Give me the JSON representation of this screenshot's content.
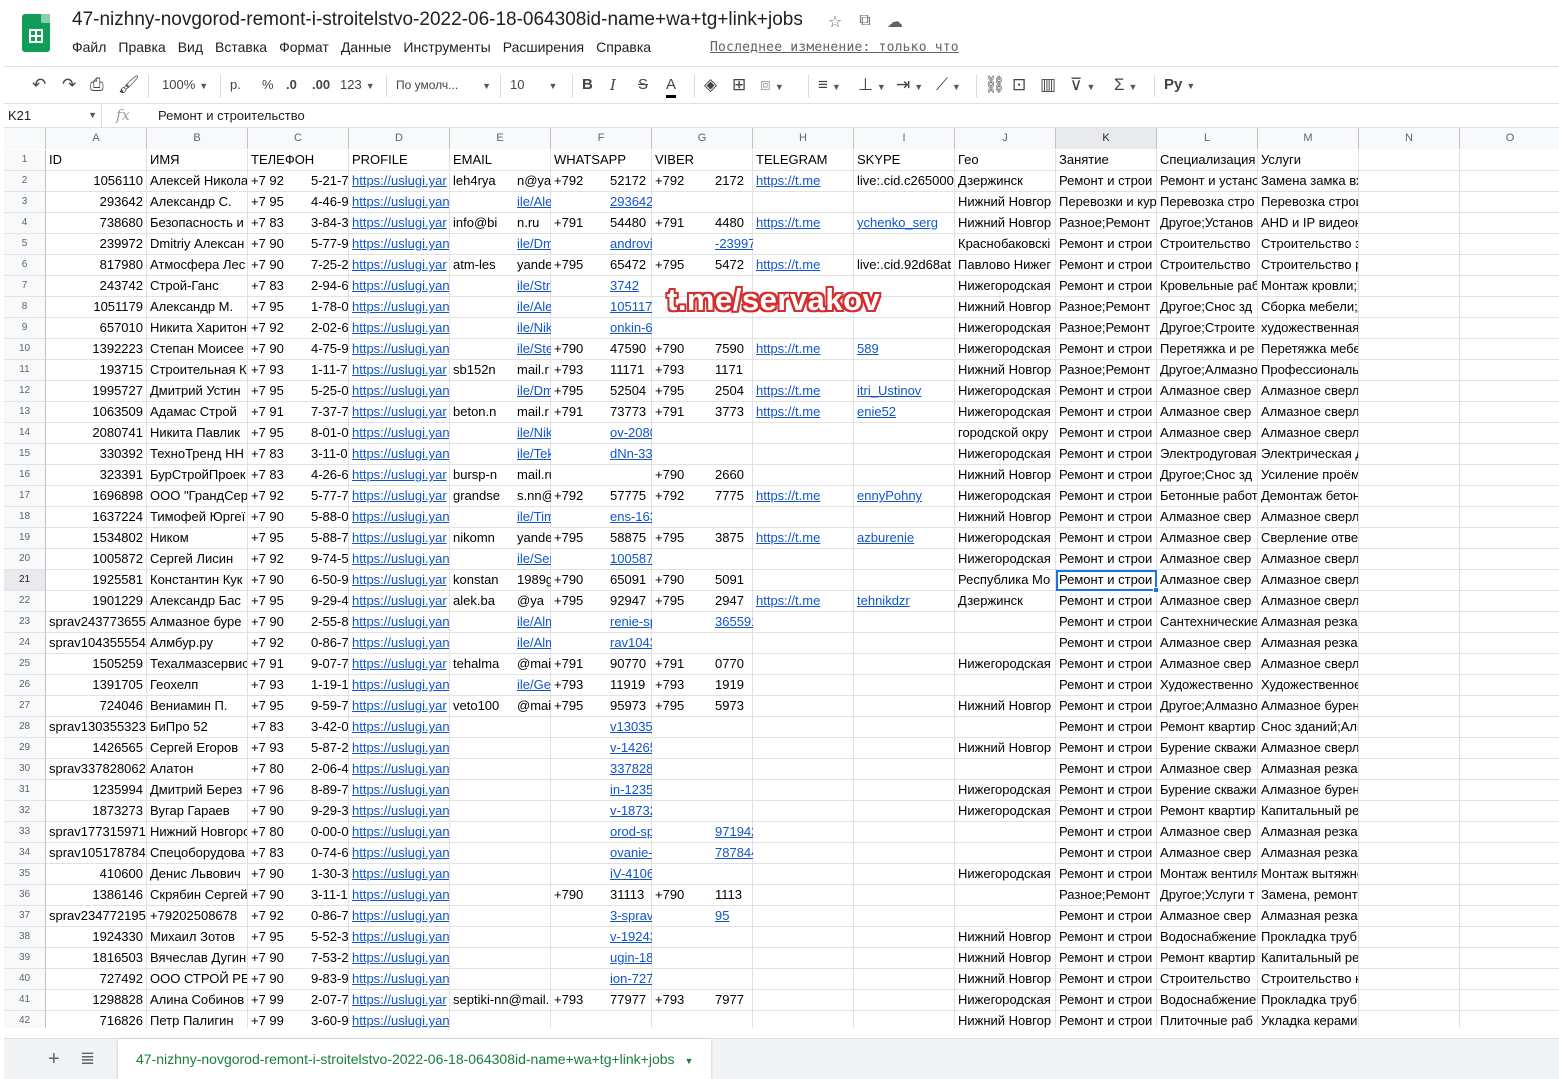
{
  "app": {
    "title": "47-nizhny-novgorod-remont-i-stroitelstvo-2022-06-18-064308id-name+wa+tg+link+jobs"
  },
  "menu": [
    "Файл",
    "Правка",
    "Вид",
    "Вставка",
    "Формат",
    "Данные",
    "Инструменты",
    "Расширения",
    "Справка"
  ],
  "last_edit": "Последнее изменение: только что",
  "title_icons": [
    "star-icon",
    "move-to-folder-icon",
    "cloud-status-icon"
  ],
  "toolbar": {
    "zoom": "100%",
    "currency": "р.",
    "percent": "%",
    "dec_decrease": ".0",
    "dec_increase": ".00",
    "more_formats": "123",
    "font": "По умолч...",
    "font_size": "10",
    "bold": "B",
    "italic": "I",
    "strike": "S",
    "text_color": "A",
    "input_tools": "Py"
  },
  "formula": {
    "namebox": "K21",
    "fx": "fx",
    "value": "Ремонт и строительство"
  },
  "columns": [
    "A",
    "B",
    "C",
    "D",
    "E",
    "F",
    "G",
    "H",
    "I",
    "J",
    "K",
    "L",
    "M",
    "N",
    "O"
  ],
  "active_column": "K",
  "active_row": 21,
  "rows": [
    {
      "n": 1,
      "c": {
        "A": "ID",
        "B": "ИМЯ",
        "C": "ТЕЛЕФОН",
        "D": "PROFILE",
        "E": "EMAIL",
        "F": "WHATSAPP",
        "G": "VIBER",
        "H": "TELEGRAM",
        "I": "SKYPE",
        "J": "Гео",
        "K": "Занятие",
        "L": "Специализация",
        "M": "Услуги"
      }
    },
    {
      "n": 2,
      "c": {
        "A": "1056110",
        "B": "Алексей Никола",
        "C": "+7 92",
        "C2": "5-21-7",
        "D": "https://uslugi.yar",
        "E": "leh4rya",
        "E2": "n@ya",
        "F": "+792",
        "F2": "52172",
        "G": "+792",
        "G2": "2172",
        "H": "https://t.me",
        "I": "live:.cid.c265000",
        "J": "Дзержинск",
        "K": "Ремонт и строи",
        "L": "Ремонт и устано",
        "M": "Замена замка входной двери;Установка замка д"
      }
    },
    {
      "n": 3,
      "c": {
        "A": "293642",
        "B": "Александр С.",
        "C": "+7 95",
        "C2": "4-46-9",
        "D": "https://uslugi.yandex.ru/p",
        "E2": "ile/Aleksan",
        "F2": "293642",
        "J": "Нижний Новгор",
        "K": "Перевозки и кур",
        "L": "Перевозка стро",
        "M": "Перевозка строительных грузов и оборудования"
      }
    },
    {
      "n": 4,
      "c": {
        "A": "738680",
        "B": "Безопасность и",
        "C": "+7 83",
        "C2": "3-84-3",
        "D": "https://uslugi.yar",
        "E": "info@bi",
        "E2": "n.ru",
        "F": "+791",
        "F2": "54480",
        "G": "+791",
        "G2": "4480",
        "H": "https://t.me",
        "I2": "ychenko_serg",
        "J": "Нижний Новгор",
        "K": "Разное;Ремонт",
        "L": "Другое;Установ",
        "M": "AHD и IP видеонаблюдения;Контроль обхода пе"
      }
    },
    {
      "n": 5,
      "c": {
        "A": "239972",
        "B": "Dmitriy Алексан",
        "C": "+7 90",
        "C2": "5-77-9",
        "D": "https://uslugi.yandex.ru/p",
        "E2": "ile/DmitriyA",
        "F2": "androvichUs",
        "G2": "-239972",
        "J": "Краснобаковскі",
        "K": "Ремонт и строи",
        "L": "Строительство",
        "M": "Строительство забора из профнастила;Монтаж"
      }
    },
    {
      "n": 6,
      "c": {
        "A": "817980",
        "B": "Атмосфера Лес",
        "C": "+7 90",
        "C2": "7-25-2",
        "D": "https://uslugi.yar",
        "E": "atm-les",
        "E2": "yande",
        "F": "+795",
        "F2": "65472",
        "G": "+795",
        "G2": "5472",
        "H": "https://t.me",
        "I": "live:.cid.92d68at",
        "J": "Павлово Нижег",
        "K": "Ремонт и строи",
        "L": "Строительство",
        "M": "Строительство русской бани;Строительство фи"
      }
    },
    {
      "n": 7,
      "c": {
        "A": "243742",
        "B": "Строй-Ганс",
        "C": "+7 83",
        "C2": "2-94-6",
        "D": "https://uslugi.yandex.ru/p",
        "E2": "ile/Strojgan",
        "F2": "3742",
        "J": "Нижегородская",
        "K": "Ремонт и строи",
        "L": "Кровельные раб",
        "M": "Монтаж кровли;Укладка утеплителя кровли;Мон"
      }
    },
    {
      "n": 8,
      "c": {
        "A": "1051179",
        "B": "Александр М.",
        "C": "+7 95",
        "C2": "1-78-0",
        "D": "https://uslugi.yandex.ru/p",
        "E2": "ile/Aleksan",
        "F2": "1051179",
        "J": "Нижний Новгор",
        "K": "Разное;Ремонт",
        "L": "Другое;Снос зд",
        "M": "Сборка мебели;Демонтаж кирпичной кладки;Де"
      }
    },
    {
      "n": 9,
      "c": {
        "A": "657010",
        "B": "Никита Харитон",
        "C": "+7 92",
        "C2": "2-02-6",
        "D": "https://uslugi.yandex.ru/p",
        "E2": "ile/NikitaKh",
        "F2": "onkin-657010",
        "J": "Нижегородская",
        "K": "Разное;Ремонт",
        "L": "Другое;Строите",
        "M": "художественная ковка;Строительство забора из"
      }
    },
    {
      "n": 10,
      "c": {
        "A": "1392223",
        "B": "Степан Моисее",
        "C": "+7 90",
        "C2": "4-75-9",
        "D": "https://uslugi.yandex.ru/p",
        "E2": "ile/Ste",
        "F": "+790",
        "F2": "47590",
        "G": "+790",
        "G2": "7590",
        "H": "https://t.me",
        "I2": "589",
        "J": "Нижегородская",
        "K": "Ремонт и строи",
        "L": "Перетяжка и ре",
        "M": "Перетяжка мебели;Перетяжка мебели;Замена н"
      }
    },
    {
      "n": 11,
      "c": {
        "A": "193715",
        "B": "Строительная К",
        "C": "+7 93",
        "C2": "1-11-7",
        "D": "https://uslugi.yar",
        "E": "sb152n",
        "E2": "mail.r",
        "F": "+793",
        "F2": "11171",
        "G": "+793",
        "G2": "1171",
        "J": "Нижний Новгор",
        "K": "Разное;Ремонт",
        "L": "Другое;Алмазно",
        "M": "Профессиональная поставка алмазного инструм"
      }
    },
    {
      "n": 12,
      "c": {
        "A": "1995727",
        "B": "Дмитрий Устин",
        "C": "+7 95",
        "C2": "5-25-0",
        "D": "https://uslugi.yandex.ru/p",
        "E2": "ile/Dm",
        "F": "+795",
        "F2": "52504",
        "G": "+795",
        "G2": "2504",
        "H": "https://t.me",
        "I2": "itri_Ustinov",
        "J": "Нижегородская",
        "K": "Ремонт и строи",
        "L": "Алмазное свер",
        "M": "Алмазное сверление"
      }
    },
    {
      "n": 13,
      "c": {
        "A": "1063509",
        "B": "Адамас Строй",
        "C": "+7 91",
        "C2": "7-37-7",
        "D": "https://uslugi.yar",
        "E": "beton.n",
        "E2": "mail.r",
        "F": "+791",
        "F2": "73773",
        "G": "+791",
        "G2": "3773",
        "H": "https://t.me",
        "I2": "enie52",
        "J": "Нижегородская",
        "K": "Ремонт и строи",
        "L": "Алмазное свер",
        "M": "Алмазное сверление;Алмазная резка"
      }
    },
    {
      "n": 14,
      "c": {
        "A": "2080741",
        "B": "Никита Павлик",
        "C": "+7 95",
        "C2": "8-01-0",
        "D": "https://uslugi.yandex.ru/p",
        "E2": "ile/NikitaPa",
        "F2": "ov-2080741",
        "J": "городской окру",
        "K": "Ремонт и строи",
        "L": "Алмазное свер",
        "M": "Алмазное сверление"
      }
    },
    {
      "n": 15,
      "c": {
        "A": "330392",
        "B": "ТехноТренд НН",
        "C": "+7 83",
        "C2": "3-11-0",
        "D": "https://uslugi.yandex.ru/p",
        "E2": "ile/Tekhnotr",
        "F2": "dNn-330392",
        "J": "Нижегородская",
        "K": "Ремонт и строи",
        "L": "Электродуговая",
        "M": "Электрическая дуговая сварка;Демонтаж бетона"
      }
    },
    {
      "n": 16,
      "c": {
        "A": "323391",
        "B": "БурСтройПроек",
        "C": "+7 83",
        "C2": "4-26-6",
        "D": "https://uslugi.yar",
        "E": "bursp-n",
        "E2": "mail.ru",
        "G": "+790",
        "G2": "2660",
        "J": "Нижний Новгор",
        "K": "Ремонт и строи",
        "L": "Другое;Снос зд",
        "M": "Усиление проёмов;Демонтаж бетона;Алмазное"
      }
    },
    {
      "n": 17,
      "c": {
        "A": "1696898",
        "B": "ООО \"ГрандСер",
        "C": "+7 92",
        "C2": "5-77-7",
        "D": "https://uslugi.yar",
        "E": "grandse",
        "E2": "s.nn@",
        "F": "+792",
        "F2": "57775",
        "G": "+792",
        "G2": "7775",
        "H": "https://t.me",
        "I2": "ennyPohny",
        "J": "Нижегородская",
        "K": "Ремонт и строи",
        "L": "Бетонные работ",
        "M": "Демонтаж бетонных конструкций;Демонтаж жел"
      }
    },
    {
      "n": 18,
      "c": {
        "A": "1637224",
        "B": "Тимофей Юргеї",
        "C": "+7 90",
        "C2": "5-88-0",
        "D": "https://uslugi.yandex.ru/p",
        "E2": "ile/TimofejY",
        "F2": "ens-1637224",
        "J": "Нижний Новгор",
        "K": "Ремонт и строи",
        "L": "Алмазное свер",
        "M": "Алмазное сверление"
      }
    },
    {
      "n": 19,
      "c": {
        "A": "1534802",
        "B": "Ником",
        "C": "+7 95",
        "C2": "5-88-7",
        "D": "https://uslugi.yar",
        "E": "nikomn",
        "E2": "yande",
        "F": "+795",
        "F2": "58875",
        "G": "+795",
        "G2": "3875",
        "H": "https://t.me",
        "I2": "azburenie",
        "J": "Нижегородская",
        "K": "Ремонт и строи",
        "L": "Алмазное свер",
        "M": "Сверление отверстий в ж/бетоне дм 20-450мм"
      }
    },
    {
      "n": 20,
      "c": {
        "A": "1005872",
        "B": "Сергей Лисин",
        "C": "+7 92",
        "C2": "9-74-5",
        "D": "https://uslugi.yandex.ru/p",
        "E2": "ile/SergejLi",
        "F2": "1005872",
        "J": "Нижегородская",
        "K": "Ремонт и строи",
        "L": "Алмазное свер",
        "M": "Алмазное сверление;Алмазная резка"
      }
    },
    {
      "n": 21,
      "c": {
        "A": "1925581",
        "B": "Константин Кук",
        "C": "+7 90",
        "C2": "6-50-9",
        "D": "https://uslugi.yar",
        "E": "konstan",
        "E2": "1989g",
        "F": "+790",
        "F2": "65091",
        "G": "+790",
        "G2": "5091",
        "J": "Республика Мо",
        "K": "Ремонт и строи",
        "L": "Алмазное свер",
        "M": "Алмазное сверление"
      }
    },
    {
      "n": 22,
      "c": {
        "A": "1901229",
        "B": "Александр Бас",
        "C": "+7 95",
        "C2": "9-29-4",
        "D": "https://uslugi.yar",
        "E": "alek.ba",
        "E2": "@ya",
        "F": "+795",
        "F2": "92947",
        "G": "+795",
        "G2": "2947",
        "H": "https://t.me",
        "I2": "tehnikdzr",
        "J": "Дзержинск",
        "K": "Ремонт и строи",
        "L": "Алмазное свер",
        "M": "Алмазное сверление;Прокладка труб водоснаб:"
      }
    },
    {
      "n": 23,
      "c": {
        "A": "sprav243773655",
        "B": "Алмазное буре",
        "C": "+7 90",
        "C2": "2-55-8",
        "D": "https://uslugi.yandex.ru/p",
        "E2": "ile/Almaznc",
        "F2": "renie-sprav2",
        "G2": "3655915",
        "K": "Ремонт и строи",
        "L": "Сантехнические",
        "M": "Алмазная резка"
      }
    },
    {
      "n": 24,
      "c": {
        "A": "sprav104355554",
        "B": "Алмбур.ру",
        "C": "+7 92",
        "C2": "0-86-7",
        "D": "https://uslugi.yandex.ru/p",
        "E2": "ile/Almburr",
        "F2": "rav10435555",
        "K": "Ремонт и строи",
        "L": "Алмазное свер",
        "M": "Алмазная резка"
      }
    },
    {
      "n": 25,
      "c": {
        "A": "1505259",
        "B": "Техалмазсервис",
        "C": "+7 91",
        "C2": "9-07-7",
        "D": "https://uslugi.yar",
        "E": "tehalma",
        "E2": "@mail.",
        "F": "+791",
        "F2": "90770",
        "G": "+791",
        "G2": "0770",
        "J": "Нижегородская",
        "K": "Ремонт и строи",
        "L": "Алмазное свер",
        "M": "Алмазное сверление;Алмазная резка"
      }
    },
    {
      "n": 26,
      "c": {
        "A": "1391705",
        "B": "Геохелп",
        "C": "+7 93",
        "C2": "1-19-1",
        "D": "https://uslugi.yandex.ru/p",
        "E2": "ile/Ge",
        "F": "+793",
        "F2": "11919",
        "G": "+793",
        "G2": "1919",
        "K": "Ремонт и строи",
        "L": "Художественно",
        "M": "Художественное литье из металла;Строительст"
      }
    },
    {
      "n": 27,
      "c": {
        "A": "724046",
        "B": "Вениамин П.",
        "C": "+7 95",
        "C2": "9-59-7",
        "D": "https://uslugi.yar",
        "E": "veto100",
        "E2": "@mail.",
        "F": "+795",
        "F2": "95973",
        "G": "+795",
        "G2": "5973",
        "J": "Нижний Новгор",
        "K": "Ремонт и строи",
        "L": "Другое;Алмазно",
        "M": "Алмазное бурение;Алмазное сверление"
      }
    },
    {
      "n": 28,
      "c": {
        "A": "sprav130355323",
        "B": "БиПро 52",
        "C": "+7 83",
        "C2": "3-42-0",
        "D": "https://uslugi.yandex.ru/profile/Bipro52-",
        "F2": "v130355323",
        "K": "Ремонт и строи",
        "L": "Ремонт квартир",
        "M": "Снос зданий;Алмазная резка"
      }
    },
    {
      "n": 29,
      "c": {
        "A": "1426565",
        "B": "Сергей Егоров",
        "C": "+7 93",
        "C2": "5-87-2",
        "D": "https://uslugi.yandex.ru/profile/SergejEg",
        "F2": "v-1426565",
        "J": "Нижний Новгор",
        "K": "Ремонт и строи",
        "L": "Бурение скважи",
        "M": "Алмазное сверление бетона;Алмазное сверлен"
      }
    },
    {
      "n": 30,
      "c": {
        "A": "sprav337828062",
        "B": "Алатон",
        "C": "+7 80",
        "C2": "2-06-4",
        "D": "https://uslugi.yandex.ru/profile/Alaton-s",
        "F2": "3378280627",
        "K": "Ремонт и строи",
        "L": "Алмазное свер",
        "M": "Алмазная резка"
      }
    },
    {
      "n": 31,
      "c": {
        "A": "1235994",
        "B": "Дмитрий Берез",
        "C": "+7 96",
        "C2": "8-89-7",
        "D": "https://uslugi.yandex.ru/profile/DmitrijBe",
        "F2": "in-1235994",
        "J": "Нижегородская",
        "K": "Ремонт и строи",
        "L": "Бурение скважи",
        "M": "Алмазное бурение железобетона;Штукатурка ст"
      }
    },
    {
      "n": 32,
      "c": {
        "A": "1873273",
        "B": "Вугар Гараев",
        "C": "+7 90",
        "C2": "9-29-3",
        "D": "https://uslugi.yandex.ru/profile/VugarGa",
        "F2": "v-1873273",
        "J": "Нижегородская",
        "K": "Ремонт и строи",
        "L": "Ремонт квартир",
        "M": "Капитальный ремонт квартиры;Ремонт ванной к"
      }
    },
    {
      "n": 33,
      "c": {
        "A": "sprav177315971",
        "B": "Нижний Новгоро",
        "C": "+7 80",
        "C2": "0-00-0",
        "D": "https://uslugi.yandex.ru/profile/NizhnijN",
        "F2": "orod-sprav17",
        "G2": "971942",
        "K": "Ремонт и строи",
        "L": "Алмазное свер",
        "M": "Алмазная резка"
      }
    },
    {
      "n": 34,
      "c": {
        "A": "sprav105178784",
        "B": "Спецоборудова",
        "C": "+7 83",
        "C2": "0-74-6",
        "D": "https://uslugi.yandex.ru/profile/Specobc",
        "F2": "ovanie-sprav",
        "G2": "787844",
        "K": "Ремонт и строи",
        "L": "Алмазное свер",
        "M": "Алмазная резка"
      }
    },
    {
      "n": 35,
      "c": {
        "A": "410600",
        "B": "Денис Львович",
        "C": "+7 90",
        "C2": "1-30-3",
        "D": "https://uslugi.yandex.ru/profile/DenisLv",
        "F2": "iV-410600",
        "J": "Нижегородская",
        "K": "Ремонт и строи",
        "L": "Монтаж вентиля",
        "M": "Монтаж вытяжной вентиляции;Монтаж приточно"
      }
    },
    {
      "n": 36,
      "c": {
        "A": "1386146",
        "B": "Скрябин Сергей",
        "C": "+7 90",
        "C2": "3-11-1",
        "D": "https://uslugi.yandex.ru/profile/Skr",
        "F": "+790",
        "F2": "31113",
        "G": "+790",
        "G2": "1113",
        "K": "Разное;Ремонт",
        "L": "Другое;Услуги т",
        "M": "Замена, ремонт дверных замков;Тайный покупа"
      }
    },
    {
      "n": 37,
      "c": {
        "A": "sprav234772195",
        "B": "+79202508678",
        "C": "+7 92",
        "C2": "0-86-7",
        "D": "https://uslugi.yandex.ru/profile/7920250",
        "F2": "3-sprav2347",
        "G2": "95",
        "K": "Ремонт и строи",
        "L": "Алмазное свер",
        "M": "Алмазная резка"
      }
    },
    {
      "n": 38,
      "c": {
        "A": "1924330",
        "B": "Михаил Зотов",
        "C": "+7 95",
        "C2": "5-52-3",
        "D": "https://uslugi.yandex.ru/profile/MikhailZ",
        "F2": "v-1924330",
        "J": "Нижний Новгор",
        "K": "Ремонт и строи",
        "L": "Водоснабжение",
        "M": "Прокладка труб водоснабжения и канализации;"
      }
    },
    {
      "n": 39,
      "c": {
        "A": "1816503",
        "B": "Вячеслав Дугин",
        "C": "+7 90",
        "C2": "7-53-2",
        "D": "https://uslugi.yandex.ru/profile/Vyaches",
        "F2": "ugin-181650",
        "J": "Нижний Новгор",
        "K": "Ремонт и строи",
        "L": "Ремонт квартир",
        "M": "Капитальный ремонт квартиры;Ремонт ванной к"
      }
    },
    {
      "n": 40,
      "c": {
        "A": "727492",
        "B": "ООО СТРОЙ РЕ",
        "C": "+7 90",
        "C2": "9-83-9",
        "D": "https://uslugi.yandex.ru/profile/OooStro",
        "F2": "ion-727492",
        "J": "Нижний Новгор",
        "K": "Ремонт и строи",
        "L": "Строительство",
        "M": "Строительство каркасного дома;Строительство"
      }
    },
    {
      "n": 41,
      "c": {
        "A": "1298828",
        "B": "Алина Собинов",
        "C": "+7 99",
        "C2": "2-07-7",
        "D": "https://uslugi.yar",
        "E": "septiki-nn@mail.",
        "F": "+793",
        "F2": "77977",
        "G": "+793",
        "G2": "7977",
        "J": "Нижегородская",
        "K": "Ремонт и строи",
        "L": "Водоснабжение",
        "M": "Прокладка труб водоснабжения и канализации;"
      }
    },
    {
      "n": 42,
      "c": {
        "A": "716826",
        "B": "Петр Палигин",
        "C": "+7 99",
        "C2": "3-60-9",
        "D": "https://uslugi.yandex.ru/profile/PetrPaligin-716826",
        "J": "Нижний Новгор",
        "K": "Ремонт и строи",
        "L": "Плиточные раб",
        "M": "Укладка керамической плитки;Укладка керамогр"
      }
    }
  ],
  "watermark": "t.me/servakov",
  "sheet_tab": "47-nizhny-novgorod-remont-i-stroitelstvo-2022-06-18-064308id-name+wa+tg+link+jobs",
  "colors": {
    "link": "#1155cc",
    "selection": "#1a73e8",
    "sheets_green": "#0f9d58",
    "tab_text": "#188038",
    "watermark_outline": "#d32f2f"
  }
}
